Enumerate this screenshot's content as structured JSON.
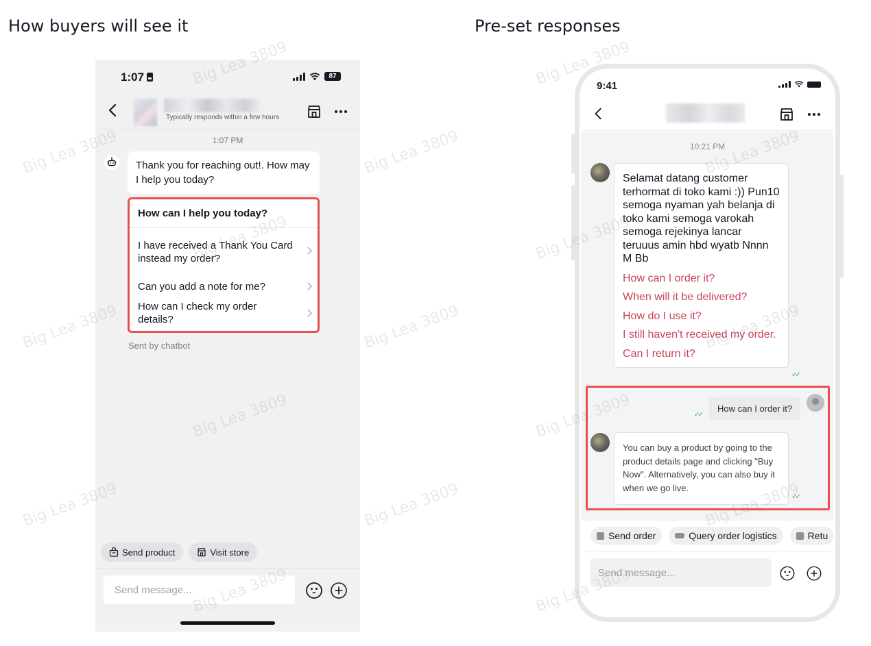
{
  "titles": {
    "left": "How buyers will see it",
    "right": "Pre-set responses"
  },
  "watermark": "Big Lea 3809",
  "left_phone": {
    "status": {
      "time": "1:07",
      "battery": "87"
    },
    "header": {
      "responds": "Typically responds within a few hours"
    },
    "timestamp": "1:07 PM",
    "bot_message": "Thank you for reaching out!. How may I help you today?",
    "faq": {
      "title": "How can I help you today?",
      "items": [
        "I have received a Thank You Card instead my order?",
        "Can you add a note for me?",
        "How can I check my order details?"
      ]
    },
    "sent_by": "Sent by chatbot",
    "chips": [
      "Send product",
      "Visit store"
    ],
    "input_placeholder": "Send message..."
  },
  "right_phone": {
    "status": {
      "time": "9:41"
    },
    "timestamp": "10:21 PM",
    "welcome_message": "Selamat datang customer terhormat di toko kami :)) Pun10 semoga nyaman yah belanja di toko kami semoga varokah semoga rejekinya lancar teruuus amin hbd wyatb Nnnn M Bb",
    "links": [
      "How can I order it?",
      "When will it be delivered?",
      "How do I use it?",
      "I still haven't received my order.",
      "Can I return it?"
    ],
    "user_message": "How can I order it?",
    "reply": "You can buy a product by going to the product details page and clicking \"Buy Now\". Alternatively, you can also buy it when we go live.",
    "chips": [
      "Send order",
      "Query order logistics",
      "Retu"
    ],
    "input_placeholder": "Send message..."
  },
  "colors": {
    "highlight": "#e8504f",
    "link": "#c6445a",
    "check": "#2fae6a"
  }
}
